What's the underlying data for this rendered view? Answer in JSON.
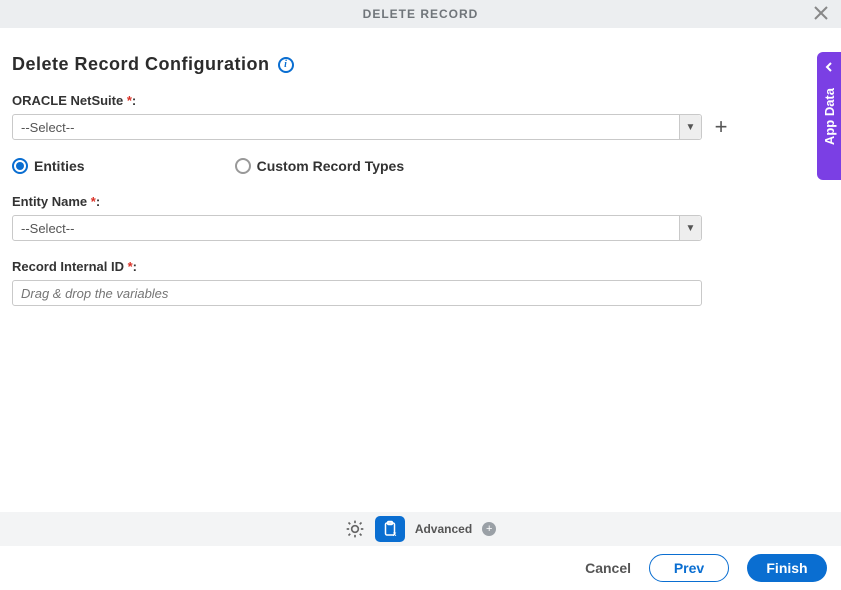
{
  "header": {
    "title": "DELETE RECORD"
  },
  "page": {
    "title": "Delete Record Configuration"
  },
  "fields": {
    "connection": {
      "label": "ORACLE NetSuite",
      "value": "--Select--"
    },
    "record_type_radios": {
      "entities": "Entities",
      "custom": "Custom Record Types"
    },
    "entity_name": {
      "label": "Entity Name",
      "value": "--Select--"
    },
    "record_internal_id": {
      "label": "Record Internal ID",
      "placeholder": "Drag & drop the variables"
    }
  },
  "side_tab": {
    "label": "App Data"
  },
  "bottom_bar": {
    "advanced": "Advanced"
  },
  "footer": {
    "cancel": "Cancel",
    "prev": "Prev",
    "finish": "Finish"
  }
}
